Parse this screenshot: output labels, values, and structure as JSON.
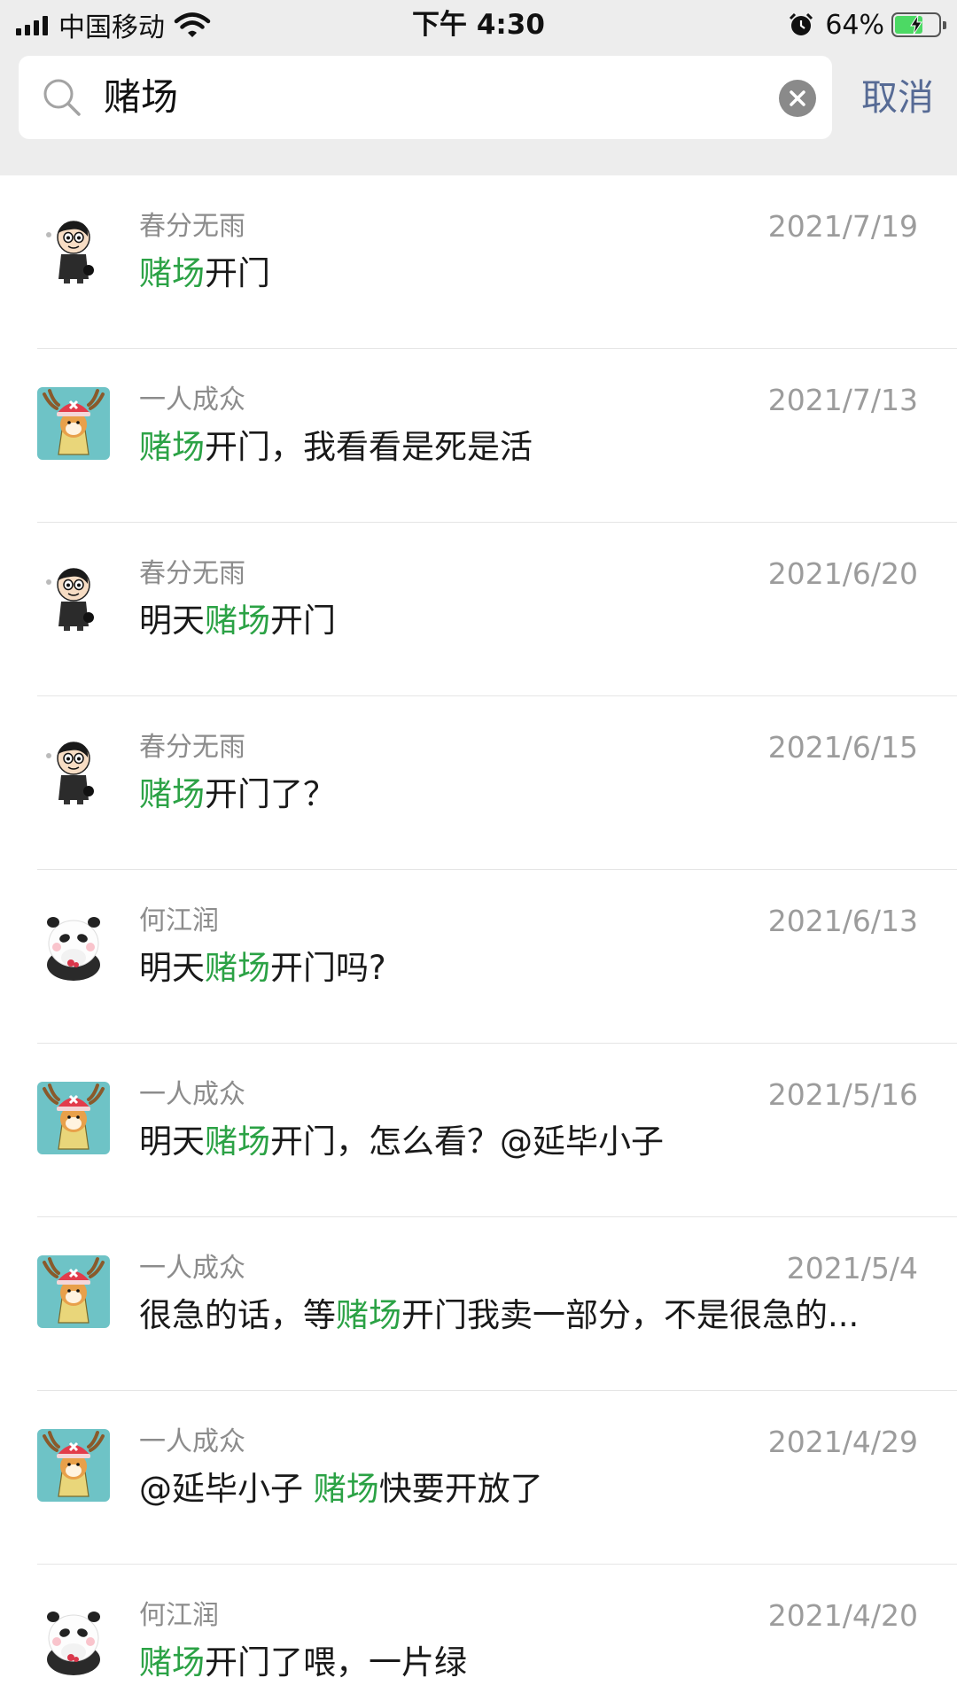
{
  "status_bar": {
    "carrier": "中国移动",
    "time": "下午 4:30",
    "battery_percent": "64%",
    "battery_level": 0.64
  },
  "search": {
    "query": "赌场",
    "cancel_label": "取消"
  },
  "results": [
    {
      "sender": "春分无雨",
      "date": "2021/7/19",
      "avatar": "shinchan-avatar",
      "parts": [
        {
          "t": "赌场",
          "h": true
        },
        {
          "t": "开门",
          "h": false
        }
      ]
    },
    {
      "sender": "一人成众",
      "date": "2021/7/13",
      "avatar": "chopper-shiba-avatar",
      "parts": [
        {
          "t": "赌场",
          "h": true
        },
        {
          "t": "开门，我看看是死是活",
          "h": false
        }
      ]
    },
    {
      "sender": "春分无雨",
      "date": "2021/6/20",
      "avatar": "shinchan-avatar",
      "parts": [
        {
          "t": "明天",
          "h": false
        },
        {
          "t": "赌场",
          "h": true
        },
        {
          "t": "开门",
          "h": false
        }
      ]
    },
    {
      "sender": "春分无雨",
      "date": "2021/6/15",
      "avatar": "shinchan-avatar",
      "parts": [
        {
          "t": "赌场",
          "h": true
        },
        {
          "t": "开门了？",
          "h": false
        }
      ]
    },
    {
      "sender": "何江润",
      "date": "2021/6/13",
      "avatar": "panda-avatar",
      "parts": [
        {
          "t": "明天",
          "h": false
        },
        {
          "t": "赌场",
          "h": true
        },
        {
          "t": "开门吗?",
          "h": false
        }
      ]
    },
    {
      "sender": "一人成众",
      "date": "2021/5/16",
      "avatar": "chopper-shiba-avatar",
      "parts": [
        {
          "t": "明天",
          "h": false
        },
        {
          "t": "赌场",
          "h": true
        },
        {
          "t": "开门，怎么看？@延毕小子",
          "h": false
        }
      ]
    },
    {
      "sender": "一人成众",
      "date": "2021/5/4",
      "avatar": "chopper-shiba-avatar",
      "parts": [
        {
          "t": "很急的话，等",
          "h": false
        },
        {
          "t": "赌场",
          "h": true
        },
        {
          "t": "开门我卖一部分，不是很急的...",
          "h": false
        }
      ]
    },
    {
      "sender": "一人成众",
      "date": "2021/4/29",
      "avatar": "chopper-shiba-avatar",
      "parts": [
        {
          "t": "@延毕小子 ",
          "h": false
        },
        {
          "t": "赌场",
          "h": true
        },
        {
          "t": "快要开放了",
          "h": false
        }
      ]
    },
    {
      "sender": "何江润",
      "date": "2021/4/20",
      "avatar": "panda-avatar",
      "parts": [
        {
          "t": "赌场",
          "h": true
        },
        {
          "t": "开门了喂，一片绿",
          "h": false
        }
      ]
    }
  ],
  "colors": {
    "highlight": "#2ba245",
    "cancel": "#576b95",
    "header_bg": "#ededed"
  }
}
